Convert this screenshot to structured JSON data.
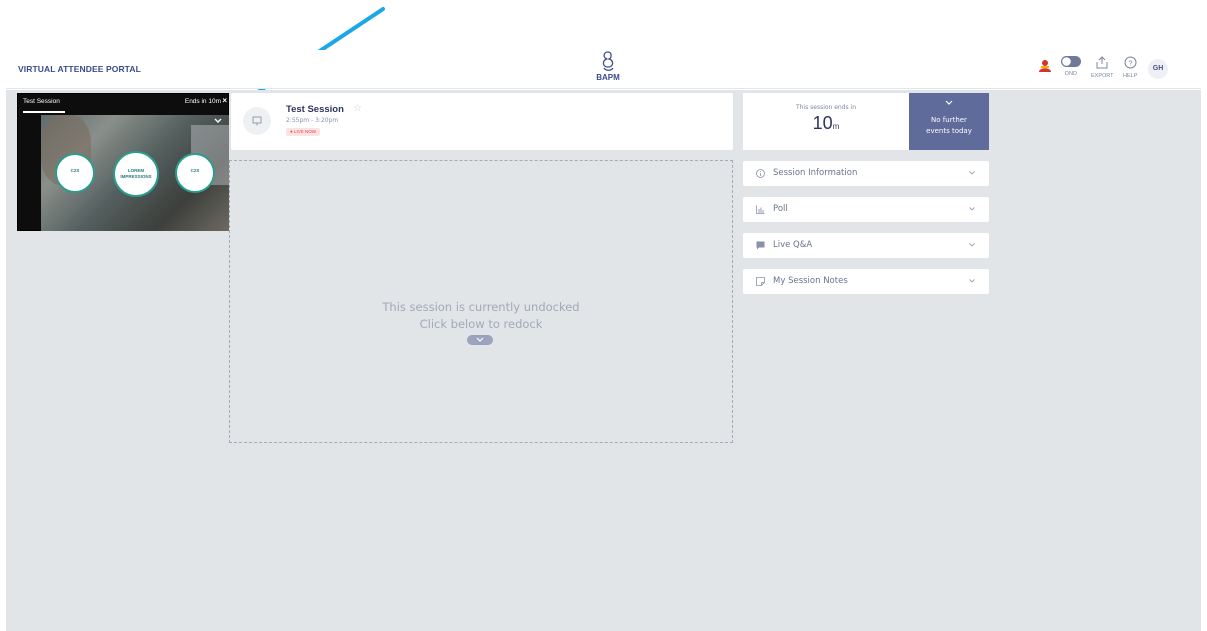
{
  "header": {
    "portal_title": "VIRTUAL ATTENDEE PORTAL",
    "logo_text": "BAPM",
    "dnd_label": "DND",
    "export_label": "EXPORT",
    "help_label": "HELP",
    "avatar_initials": "GH"
  },
  "session": {
    "title": "Test Session",
    "time": "2:55pm - 3:20pm",
    "live_badge": "● LIVE NOW"
  },
  "undocked": {
    "line1": "This session is currently undocked",
    "line2": "Click below to redock"
  },
  "timer": {
    "label": "This session ends in",
    "value": "10",
    "unit": "m"
  },
  "next_events": {
    "line1": "No further",
    "line2": "events today"
  },
  "panels": [
    {
      "label": "Session Information",
      "icon": "info-icon"
    },
    {
      "label": "Poll",
      "icon": "poll-chart-icon"
    },
    {
      "label": "Live Q&A",
      "icon": "chat-bubble-icon"
    },
    {
      "label": "My Session Notes",
      "icon": "notes-icon"
    }
  ],
  "player": {
    "title": "Test Session",
    "ends": "Ends in 10m",
    "close": "×",
    "circles": [
      "C2S",
      "LOREM IMPRESSIONS",
      "C2S"
    ]
  },
  "colors": {
    "brand": "#3c4a8e",
    "accent_card": "#5f6b9a",
    "live": "#e04848",
    "arrow": "#1aa9e6",
    "background": "#e2e5e7"
  }
}
